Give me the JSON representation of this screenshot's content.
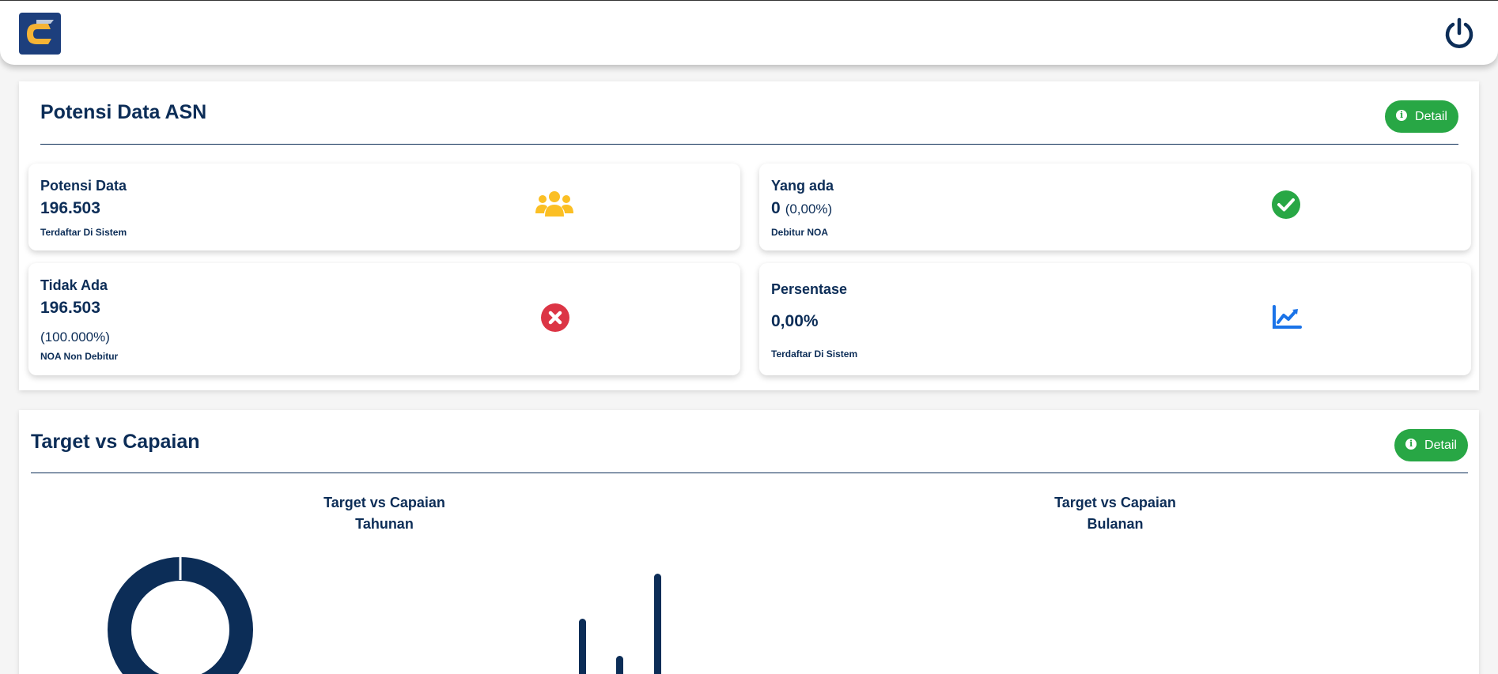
{
  "navbar": {
    "logo_icon": "app-logo",
    "power_icon": "power-icon"
  },
  "potensi": {
    "title": "Potensi Data ASN",
    "detail_label": "Detail",
    "cards": {
      "potensi_data": {
        "title": "Potensi Data",
        "value": "196.503",
        "sub": "Terdaftar Di Sistem",
        "icon": "users-icon"
      },
      "yang_ada": {
        "title": "Yang ada",
        "value": "0",
        "paren": "(0,00%)",
        "sub": "Debitur NOA",
        "icon": "check-circle-icon"
      },
      "tidak_ada": {
        "title": "Tidak Ada",
        "value": "196.503",
        "paren": "(100.000%)",
        "sub": "NOA Non Debitur",
        "icon": "times-circle-icon"
      },
      "persentase": {
        "title": "Persentase",
        "value": "0,00%",
        "sub": "Terdaftar Di Sistem",
        "icon": "chart-line-icon"
      }
    }
  },
  "target": {
    "title": "Target vs Capaian",
    "detail_label": "Detail",
    "chart_tahunan": {
      "line1": "Target vs Capaian",
      "line2": "Tahunan"
    },
    "chart_bulanan": {
      "line1": "Target vs Capaian",
      "line2": "Bulanan"
    }
  },
  "colors": {
    "navy": "#0c2d57",
    "green": "#28a745",
    "yellow": "#fbbf24",
    "red": "#dc3545",
    "blue": "#1a73e8"
  }
}
